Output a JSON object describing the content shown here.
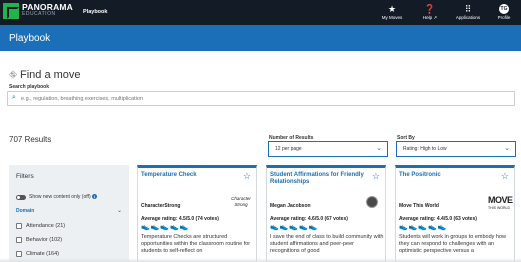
{
  "topbar": {
    "logo_main": "PANORAMA",
    "logo_sub": "EDUCATION",
    "app_name": "Playbook",
    "nav": [
      {
        "label": "My Moves",
        "icon": "star-icon"
      },
      {
        "label": "Help ↗",
        "icon": "help-icon"
      },
      {
        "label": "Applications",
        "icon": "grid-icon"
      },
      {
        "label": "Profile",
        "icon": "profile-icon",
        "initials": "TG"
      }
    ]
  },
  "header": {
    "title": "Playbook"
  },
  "find": {
    "title": "Find a move",
    "search_label": "Search playbook",
    "search_placeholder": "e.g., regulation, breathing exercises, multiplication"
  },
  "results": {
    "count_text": "707 Results",
    "number_label": "Number of Results",
    "number_value": "12 per page",
    "sort_label": "Sort By",
    "sort_value": "Rating: High to Low"
  },
  "filters": {
    "title": "Filters",
    "toggle_label": "Show new content only (off)",
    "domain_label": "Domain",
    "options": [
      "Attendance (21)",
      "Behavior (102)",
      "Climate (164)"
    ]
  },
  "cards": [
    {
      "title": "Temperature Check",
      "author": "CharacterStrong",
      "rating": "Average rating: 4.5/5.0 (74 votes)",
      "description": "Temperature Checks are structured opportunities within the classroom routine for students to self-reflect on",
      "logo_text": "Character Strong"
    },
    {
      "title": "Student Affirmations for Friendly Relationships",
      "author": "Megan Jacobson",
      "rating": "Average rating: 4.6/5.0 (67 votes)",
      "description": "I save the end of class to build community with student affirmations and peer-peer recognitions of good"
    },
    {
      "title": "The Positronic",
      "author": "Move This World",
      "rating": "Average rating: 4.4/5.0 (63 votes)",
      "description": "Students will work in groups to embody how they can respond to challenges with an optimistic perspective versus a",
      "logo_text": "MOVE",
      "logo_sub": "THIS WORLD"
    }
  ],
  "colors": {
    "brand_blue": "#1b6fb9",
    "topbar": "#131c26",
    "logo_green": "#24b24a",
    "shoe_green": "#2a8a3a"
  }
}
